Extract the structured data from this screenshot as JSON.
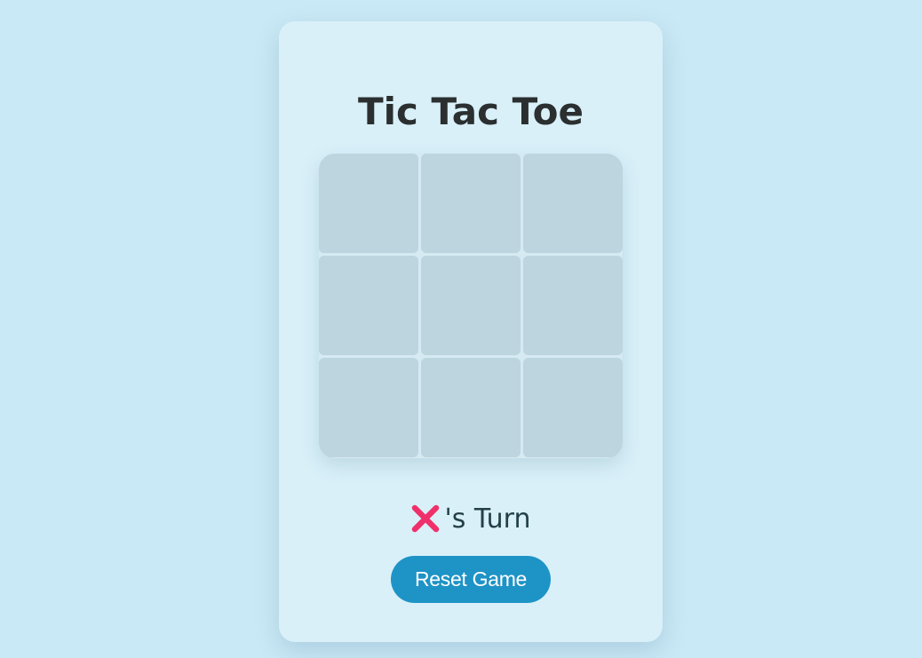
{
  "game": {
    "title": "Tic Tac Toe",
    "board": [
      "",
      "",
      "",
      "",
      "",
      "",
      "",
      "",
      ""
    ],
    "current_player": "X",
    "current_player_icon": "cross-mark-icon",
    "turn_suffix": "'s Turn",
    "reset_label": "Reset Game"
  },
  "colors": {
    "background": "#cae9f6",
    "card": "#d9f0f9",
    "cell": "#bdd5de",
    "x_mark": "#f0306a",
    "button": "#1e93c6",
    "title_text": "#2b2f30"
  }
}
